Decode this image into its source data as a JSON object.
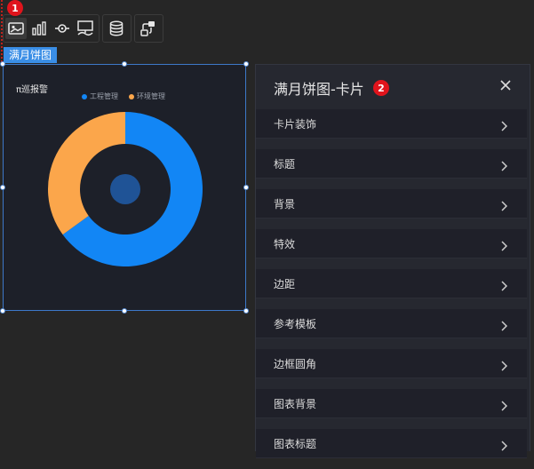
{
  "markers": {
    "toolbar_marker": "1",
    "panel_marker": "2"
  },
  "toolbar": {
    "groups": [
      {
        "items": [
          "picture-icon",
          "bar-chart-icon",
          "eye-target-icon",
          "chart-box-icon"
        ]
      },
      {
        "items": [
          "database-icon"
        ]
      },
      {
        "items": [
          "link-flow-icon"
        ]
      }
    ]
  },
  "component_tag": "满月饼图",
  "chart_data": {
    "type": "pie",
    "title": "π巡报警",
    "legend_position": "top-center",
    "series": [
      {
        "name": "工程管理",
        "value": 0.65,
        "color": "#1286f5"
      },
      {
        "name": "环境管理",
        "value": 0.35,
        "color": "#fba64b"
      }
    ],
    "inner_color": "#1f5396"
  },
  "panel": {
    "title": "满月饼图-卡片",
    "close_icon": "close-icon",
    "rows": [
      {
        "label": "卡片装饰"
      },
      {
        "label": "标题"
      },
      {
        "label": "背景"
      },
      {
        "label": "特效"
      },
      {
        "label": "边距"
      },
      {
        "label": "参考模板"
      },
      {
        "label": "边框圆角"
      },
      {
        "label": "图表背景"
      },
      {
        "label": "图表标题"
      }
    ]
  },
  "colors": {
    "accent": "#3a8ee6",
    "marker": "#e0141c",
    "background": "#262626",
    "card_bg": "#1d2029",
    "panel_bg": "#262830",
    "row_bg": "#1f2029"
  }
}
